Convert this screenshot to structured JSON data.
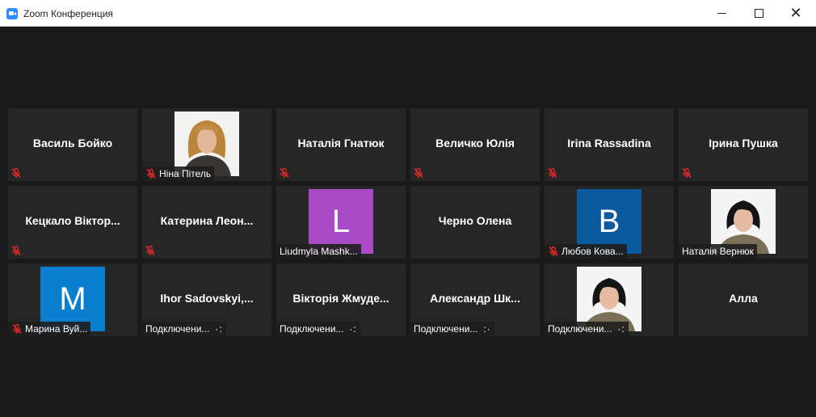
{
  "window": {
    "title": "Zoom Конференция",
    "minimize_icon": "minimize-icon",
    "maximize_icon": "maximize-icon",
    "close_icon": "close-icon"
  },
  "colors": {
    "tile_bg": "#262626",
    "mute_red": "#e02828",
    "purple_avatar": "#a94bc4",
    "blue_avatar": "#0b5a9e",
    "lightblue_avatar": "#0a7fd0"
  },
  "participants": [
    {
      "name": "Василь Бойко",
      "muted": true,
      "type": "name"
    },
    {
      "label": "Ніна Пітель",
      "muted": true,
      "type": "photo"
    },
    {
      "name": "Наталія Гнатюк",
      "muted": true,
      "type": "name"
    },
    {
      "name": "Величко Юлія",
      "muted": true,
      "type": "name"
    },
    {
      "name": "Irina Rassadina",
      "muted": true,
      "type": "name"
    },
    {
      "name": "Ірина Пушка",
      "muted": true,
      "type": "name"
    },
    {
      "name": "Кецкало Віктор...",
      "muted": true,
      "type": "name"
    },
    {
      "name": "Катерина Леон...",
      "muted": true,
      "type": "name"
    },
    {
      "label": "Liudmyla Mashk...",
      "avatar_letter": "L",
      "muted": false,
      "type": "avatar"
    },
    {
      "name": "Черно Олена",
      "muted": false,
      "type": "name"
    },
    {
      "label": "Любов Кова...",
      "avatar_letter": "B",
      "muted": true,
      "type": "avatar"
    },
    {
      "label": "Наталія Вернюк",
      "muted": false,
      "type": "photo"
    },
    {
      "label": "Марина Вуй...",
      "avatar_letter": "M",
      "muted": true,
      "type": "avatar"
    },
    {
      "name": "Ihor Sadovskyi,...",
      "status": "Подключени...",
      "type": "connecting"
    },
    {
      "name": "Вікторія Жмуде...",
      "status": "Подключени...",
      "type": "connecting"
    },
    {
      "name": "Александр Шк...",
      "status": "Подключени...",
      "type": "connecting"
    },
    {
      "status": "Подключени...",
      "type": "photo-connecting"
    },
    {
      "name": "Алла",
      "muted": false,
      "type": "name"
    }
  ]
}
